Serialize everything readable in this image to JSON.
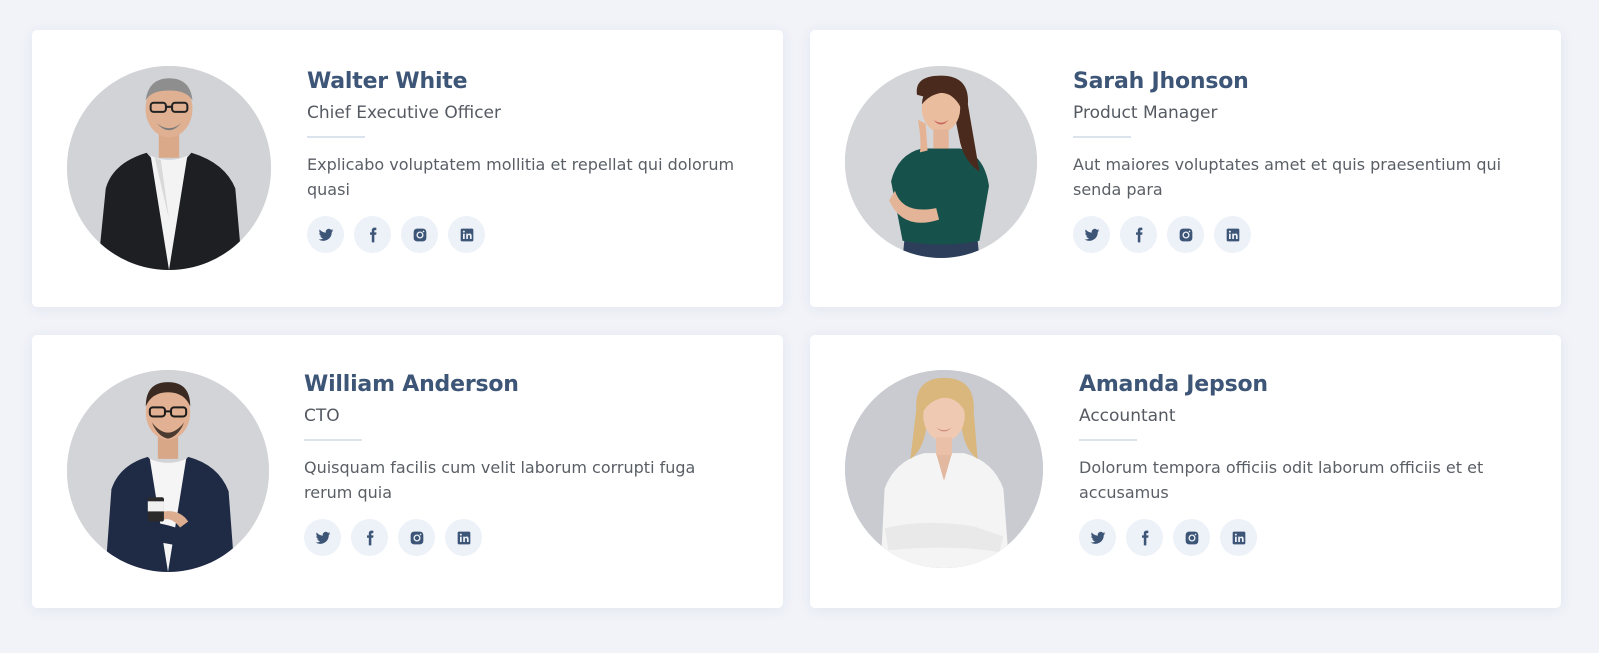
{
  "members": [
    {
      "name": "Walter White",
      "role": "Chief Executive Officer",
      "description": "Explicabo voluptatem mollitia et repellat qui dolorum quasi",
      "photo": "man-black-jacket"
    },
    {
      "name": "Sarah Jhonson",
      "role": "Product Manager",
      "description": "Aut maiores voluptates amet et quis praesentium qui senda para",
      "photo": "woman-green-top"
    },
    {
      "name": "William Anderson",
      "role": "CTO",
      "description": "Quisquam facilis cum velit laborum corrupti fuga rerum quia",
      "photo": "man-navy-suit-coffee"
    },
    {
      "name": "Amanda Jepson",
      "role": "Accountant",
      "description": "Dolorum tempora officiis odit laborum officiis et et accusamus",
      "photo": "woman-white-blouse"
    }
  ],
  "social_icons": [
    "twitter-icon",
    "facebook-icon",
    "instagram-icon",
    "linkedin-icon"
  ],
  "colors": {
    "page_background": "#f1f3f9",
    "card_background": "#ffffff",
    "name_color": "#3d5576",
    "icon_color": "#3d5576",
    "icon_background": "#edf1f8"
  }
}
